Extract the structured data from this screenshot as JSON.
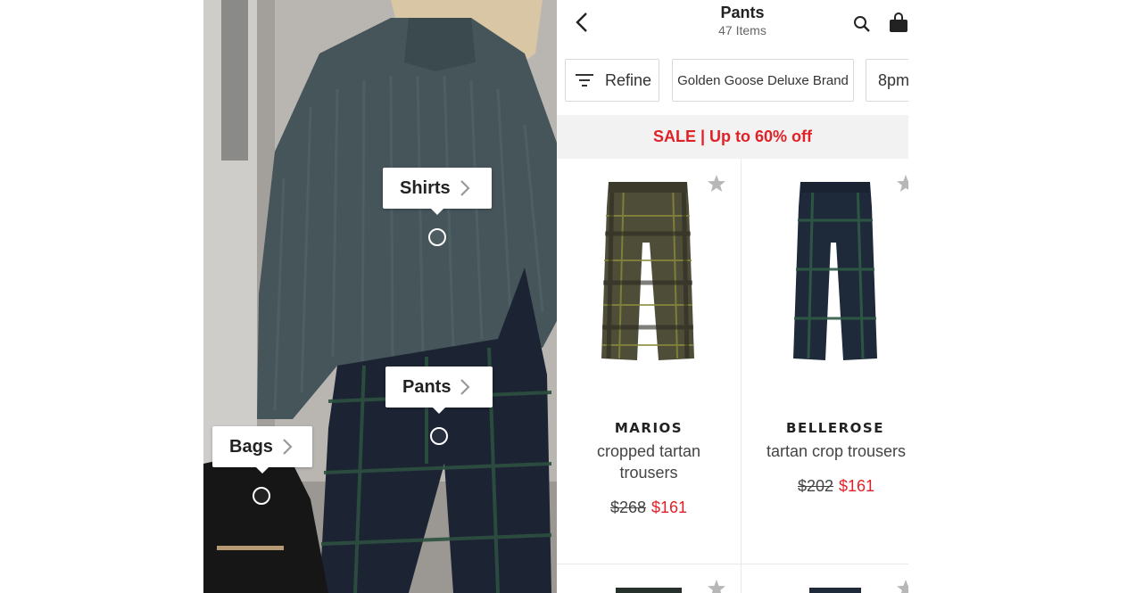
{
  "photo": {
    "tags": [
      {
        "label": "Shirts"
      },
      {
        "label": "Pants"
      },
      {
        "label": "Bags"
      }
    ]
  },
  "header": {
    "title": "Pants",
    "count": "47 Items",
    "icons": [
      "back-arrow-icon",
      "search-icon",
      "shopping-bag-icon"
    ]
  },
  "filters": {
    "refine": "Refine",
    "brand_chip": "Golden Goose Deluxe Brand",
    "more_chip": "8pm"
  },
  "sale_banner": "SALE | Up to 60% off",
  "products": [
    {
      "brand": "MARIOS",
      "name": "cropped tartan trousers",
      "old_price": "$268",
      "new_price": "$161"
    },
    {
      "brand": "BELLEROSE",
      "name": "tartan crop trousers",
      "old_price": "$202",
      "new_price": "$161"
    }
  ],
  "colors": {
    "accent_red": "#e02128",
    "sale_bg": "#f2f2f2",
    "star_grey": "#b7b7b7"
  }
}
